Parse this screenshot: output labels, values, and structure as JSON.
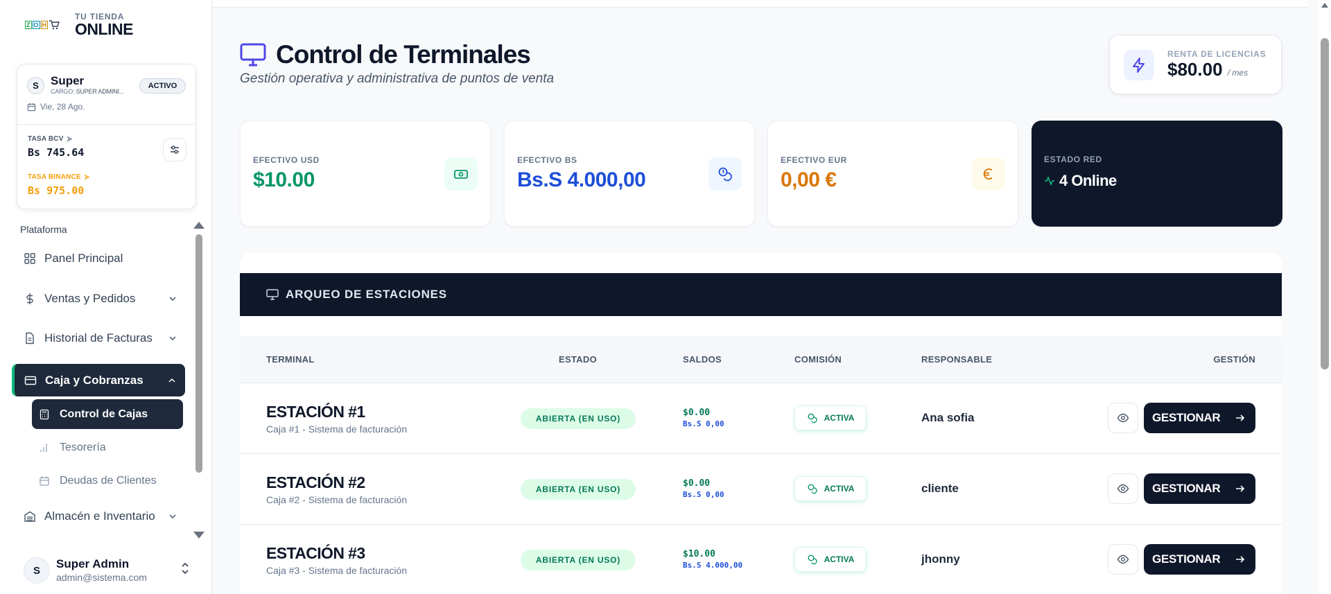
{
  "brand": {
    "logo_text": "ZOHO",
    "subtitle": "TU TIENDA",
    "title": "ONLINE"
  },
  "user_card": {
    "avatar": "S",
    "name": "Super",
    "cargo_label": "CARGO:",
    "cargo_value": "SUPER ADMINI...",
    "badge": "ACTIVO",
    "date": "Vie, 28 Ago.",
    "bcv_label": "TASA BCV",
    "bcv_value": "Bs 745.64",
    "binance_label": "TASA BINANCE",
    "binance_value": "Bs 975.00"
  },
  "sidebar": {
    "section": "Plataforma",
    "items": [
      {
        "label": "Panel Principal",
        "icon": "grid-icon"
      },
      {
        "label": "Ventas y Pedidos",
        "icon": "dollar-icon"
      },
      {
        "label": "Historial de Facturas",
        "icon": "file-icon"
      },
      {
        "label": "Caja y Cobranzas",
        "icon": "card-icon"
      },
      {
        "label": "Almacén e Inventario",
        "icon": "warehouse-icon"
      }
    ],
    "sub_items": [
      {
        "label": "Control de Cajas",
        "icon": "calculator-icon"
      },
      {
        "label": "Tesorería",
        "icon": "bar-chart-icon"
      },
      {
        "label": "Deudas de Clientes",
        "icon": "calendar-icon"
      }
    ]
  },
  "footer_user": {
    "avatar": "S",
    "name": "Super Admin",
    "email": "admin@sistema.com"
  },
  "page": {
    "title": "Control de Terminales",
    "subtitle": "Gestión operativa y administrativa de puntos de venta"
  },
  "license": {
    "label": "RENTA DE LICENCIAS",
    "value": "$80.00",
    "unit": "/ mes"
  },
  "cards": [
    {
      "label": "EFECTIVO USD",
      "value": "$10.00",
      "color": "#059669",
      "icon": "cash-icon"
    },
    {
      "label": "EFECTIVO BS",
      "value": "Bs.S 4.000,00",
      "color": "#1d4ed8",
      "icon": "coins-icon"
    },
    {
      "label": "EFECTIVO EUR",
      "value": "0,00 €",
      "color": "#d97706",
      "icon": "euro-icon"
    },
    {
      "label": "ESTADO RED",
      "value": "4 Online",
      "color": "#ffffff",
      "icon": "activity-icon"
    }
  ],
  "table": {
    "title": "ARQUEO DE ESTACIONES",
    "columns": [
      "TERMINAL",
      "ESTADO",
      "SALDOS",
      "COMISIÓN",
      "RESPONSABLE",
      "GESTIÓN"
    ],
    "rows": [
      {
        "name": "ESTACIÓN #1",
        "desc": "Caja #1 - Sistema de facturación",
        "state": "ABIERTA (EN USO)",
        "usd": "$0.00",
        "bs": "Bs.S 0,00",
        "commission": "ACTIVA",
        "responsible": "Ana sofia",
        "action": "GESTIONAR"
      },
      {
        "name": "ESTACIÓN #2",
        "desc": "Caja #2 - Sistema de facturación",
        "state": "ABIERTA (EN USO)",
        "usd": "$0.00",
        "bs": "Bs.S 0,00",
        "commission": "ACTIVA",
        "responsible": "cliente",
        "action": "GESTIONAR"
      },
      {
        "name": "ESTACIÓN #3",
        "desc": "Caja #3 - Sistema de facturación",
        "state": "ABIERTA (EN USO)",
        "usd": "$10.00",
        "bs": "Bs.S 4.000,00",
        "commission": "ACTIVA",
        "responsible": "jhonny",
        "action": "GESTIONAR"
      }
    ]
  }
}
